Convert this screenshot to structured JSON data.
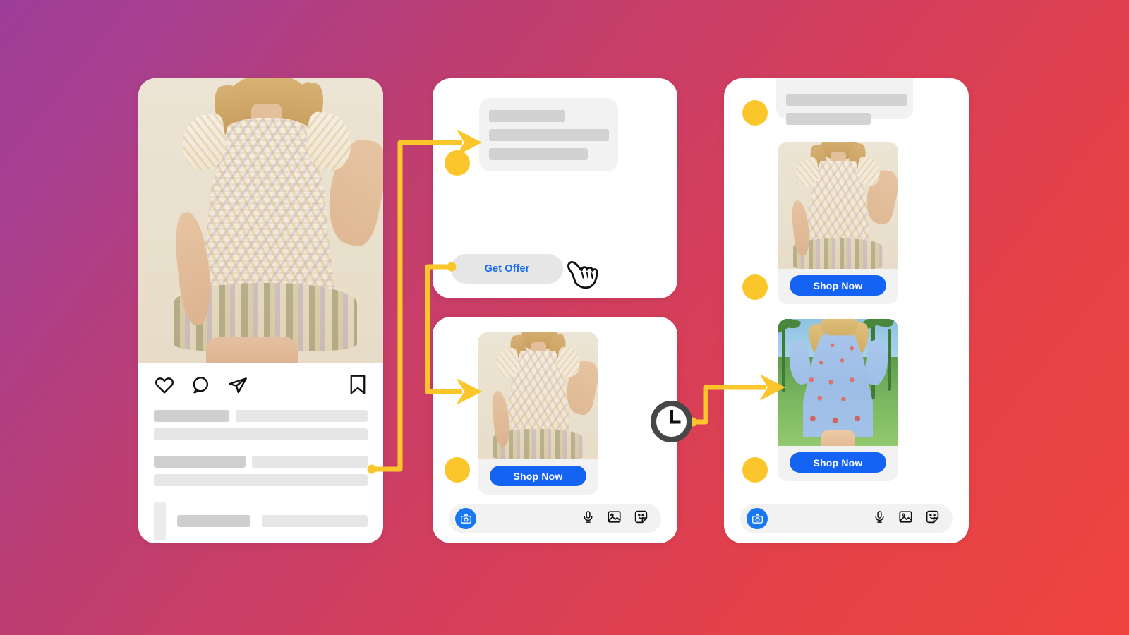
{
  "background": {
    "gradient_from": "#9E3E99",
    "gradient_mid": "#CE3E62",
    "gradient_to": "#EF4440"
  },
  "accent": {
    "yellow": "#FBC62C",
    "blue_primary": "#1463F3",
    "blue_link": "#176BF0",
    "blue_camera": "#1877F2",
    "placeholder_dark": "#cfcfcf",
    "placeholder_light": "#e6e6e6"
  },
  "instagram_post": {
    "name": "instagram-post-card",
    "image_alt": "Model wearing cream floral ruffle-sleeve dress",
    "actions": [
      {
        "name": "like-icon",
        "label": "Like"
      },
      {
        "name": "comment-icon",
        "label": "Comment"
      },
      {
        "name": "share-icon",
        "label": "Share"
      },
      {
        "name": "bookmark-icon",
        "label": "Save"
      }
    ]
  },
  "message_card_top": {
    "name": "dm-conversation-card",
    "bubble": {
      "name": "incoming-message-bubble",
      "lines": 3
    },
    "get_offer_button": {
      "label": "Get Offer",
      "text_color": "#176BF0",
      "background": "#e6e6e6"
    },
    "cursor": {
      "name": "hand-cursor-icon",
      "label": "Click"
    }
  },
  "message_card_bottom": {
    "name": "dm-product-card",
    "product": {
      "name": "product-cream-dress",
      "image_alt": "Cream floral ruffle-sleeve dress",
      "cta_label": "Shop Now"
    },
    "composer": {
      "name": "message-composer",
      "camera_button": {
        "name": "camera-icon",
        "label": "Camera"
      },
      "icons": [
        {
          "name": "microphone-icon",
          "label": "Voice message"
        },
        {
          "name": "image-icon",
          "label": "Photo"
        },
        {
          "name": "sticker-icon",
          "label": "Sticker"
        }
      ]
    }
  },
  "right_card": {
    "name": "dm-followup-card",
    "bubble": {
      "name": "incoming-message-bubble",
      "lines": 2
    },
    "products": [
      {
        "name": "product-cream-dress",
        "image_alt": "Cream floral ruffle-sleeve dress",
        "cta_label": "Shop Now"
      },
      {
        "name": "product-blue-dress",
        "image_alt": "Blue printed puff-sleeve dress outdoors",
        "cta_label": "Shop Now"
      }
    ],
    "composer": {
      "name": "message-composer",
      "camera_button": {
        "name": "camera-icon",
        "label": "Camera"
      },
      "icons": [
        {
          "name": "microphone-icon",
          "label": "Voice message"
        },
        {
          "name": "image-icon",
          "label": "Photo"
        },
        {
          "name": "sticker-icon",
          "label": "Sticker"
        }
      ]
    }
  },
  "annotations": {
    "delay_badge": {
      "name": "clock-icon",
      "label": "Time delay"
    },
    "step_dots": [
      {
        "name": "step-dot-1"
      },
      {
        "name": "step-dot-2"
      },
      {
        "name": "step-dot-3"
      },
      {
        "name": "step-dot-4"
      },
      {
        "name": "step-dot-5"
      },
      {
        "name": "step-dot-6"
      }
    ],
    "flow_arrows": [
      {
        "name": "flow-arrow-post-to-message"
      },
      {
        "name": "flow-arrow-offer-to-product"
      },
      {
        "name": "flow-arrow-delay-to-followup"
      }
    ]
  }
}
